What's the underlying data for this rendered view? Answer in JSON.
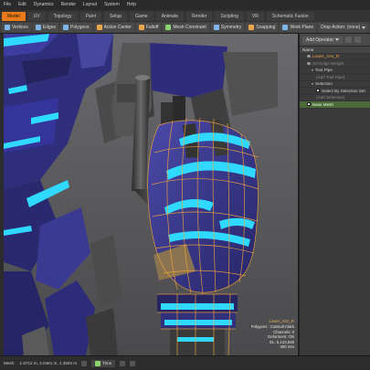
{
  "menubar": {
    "items": [
      "File",
      "Edit",
      "Dynamics",
      "Render",
      "Layout",
      "System",
      "Help"
    ]
  },
  "modebar": {
    "tabs": [
      {
        "label": "Model",
        "active": true
      },
      {
        "label": "UV",
        "active": false
      },
      {
        "label": "Topology",
        "active": false
      },
      {
        "label": "Paint",
        "active": false
      },
      {
        "label": "Setup",
        "active": false
      },
      {
        "label": "Game",
        "active": false
      },
      {
        "label": "Animate",
        "active": false
      },
      {
        "label": "Render",
        "active": false
      },
      {
        "label": "Scripting",
        "active": false
      },
      {
        "label": "VR",
        "active": false
      },
      {
        "label": "Schematic Fusion",
        "active": false
      }
    ]
  },
  "toolbar": {
    "items": [
      {
        "label": "Vertices",
        "icon": "vertices-icon",
        "active": false
      },
      {
        "label": "Edges",
        "icon": "edges-icon",
        "active": false
      },
      {
        "label": "Polygons",
        "icon": "polygons-icon",
        "active": false
      },
      {
        "label": "Action Center",
        "icon": "action-center-icon",
        "active": false
      },
      {
        "label": "Falloff",
        "icon": "falloff-icon",
        "active": false
      },
      {
        "label": "Mesh Constraint",
        "icon": "mesh-constraint-icon",
        "active": false
      },
      {
        "label": "Symmetry",
        "icon": "symmetry-icon",
        "active": false
      },
      {
        "label": "Snapping",
        "icon": "snapping-icon",
        "active": false
      },
      {
        "label": "Work Plane",
        "icon": "work-plane-icon",
        "active": false
      },
      {
        "label": "Drop Action: (none)",
        "icon": "drop-action-icon",
        "active": false
      }
    ]
  },
  "panel": {
    "add_operator": "Add Operator",
    "tree": [
      {
        "label": "Name",
        "indent": 0,
        "style": "header",
        "marker": "none"
      },
      {
        "label": "Lower_Arm_R",
        "indent": 1,
        "style": "orange",
        "marker": "eye"
      },
      {
        "label": "Set Edge Weight",
        "indent": 1,
        "style": "dim",
        "marker": "eye"
      },
      {
        "label": "Tool Pipe",
        "indent": 2,
        "style": "normal",
        "marker": "tri"
      },
      {
        "label": "(Add Tool Pipe)",
        "indent": 3,
        "style": "dim",
        "marker": "none"
      },
      {
        "label": "Selection",
        "indent": 2,
        "style": "normal",
        "marker": "tri"
      },
      {
        "label": "Select By Selection Set",
        "indent": 3,
        "style": "normal",
        "marker": "chk"
      },
      {
        "label": "(Add Selection)",
        "indent": 3,
        "style": "dim",
        "marker": "none"
      },
      {
        "label": "Base Mesh",
        "indent": 1,
        "style": "hl",
        "marker": "chk"
      }
    ]
  },
  "hud": {
    "lines": [
      "Lower_Arm_R",
      "Polygons : Catmull-Clark",
      "Channels: 0",
      "Deformers: ON",
      "GL: 5,123,846",
      "300 mm"
    ]
  },
  "statusbar": {
    "mesh_label": "Mesh:",
    "coords": "1.6712 m, 2.0461 m, 1.3504 m",
    "time_label": "Time"
  },
  "colors": {
    "accent_orange": "#e87b18",
    "armor_blue": "#3b3a92",
    "glow_cyan": "#2fd9ff",
    "wire_orange": "#f2a33a"
  }
}
